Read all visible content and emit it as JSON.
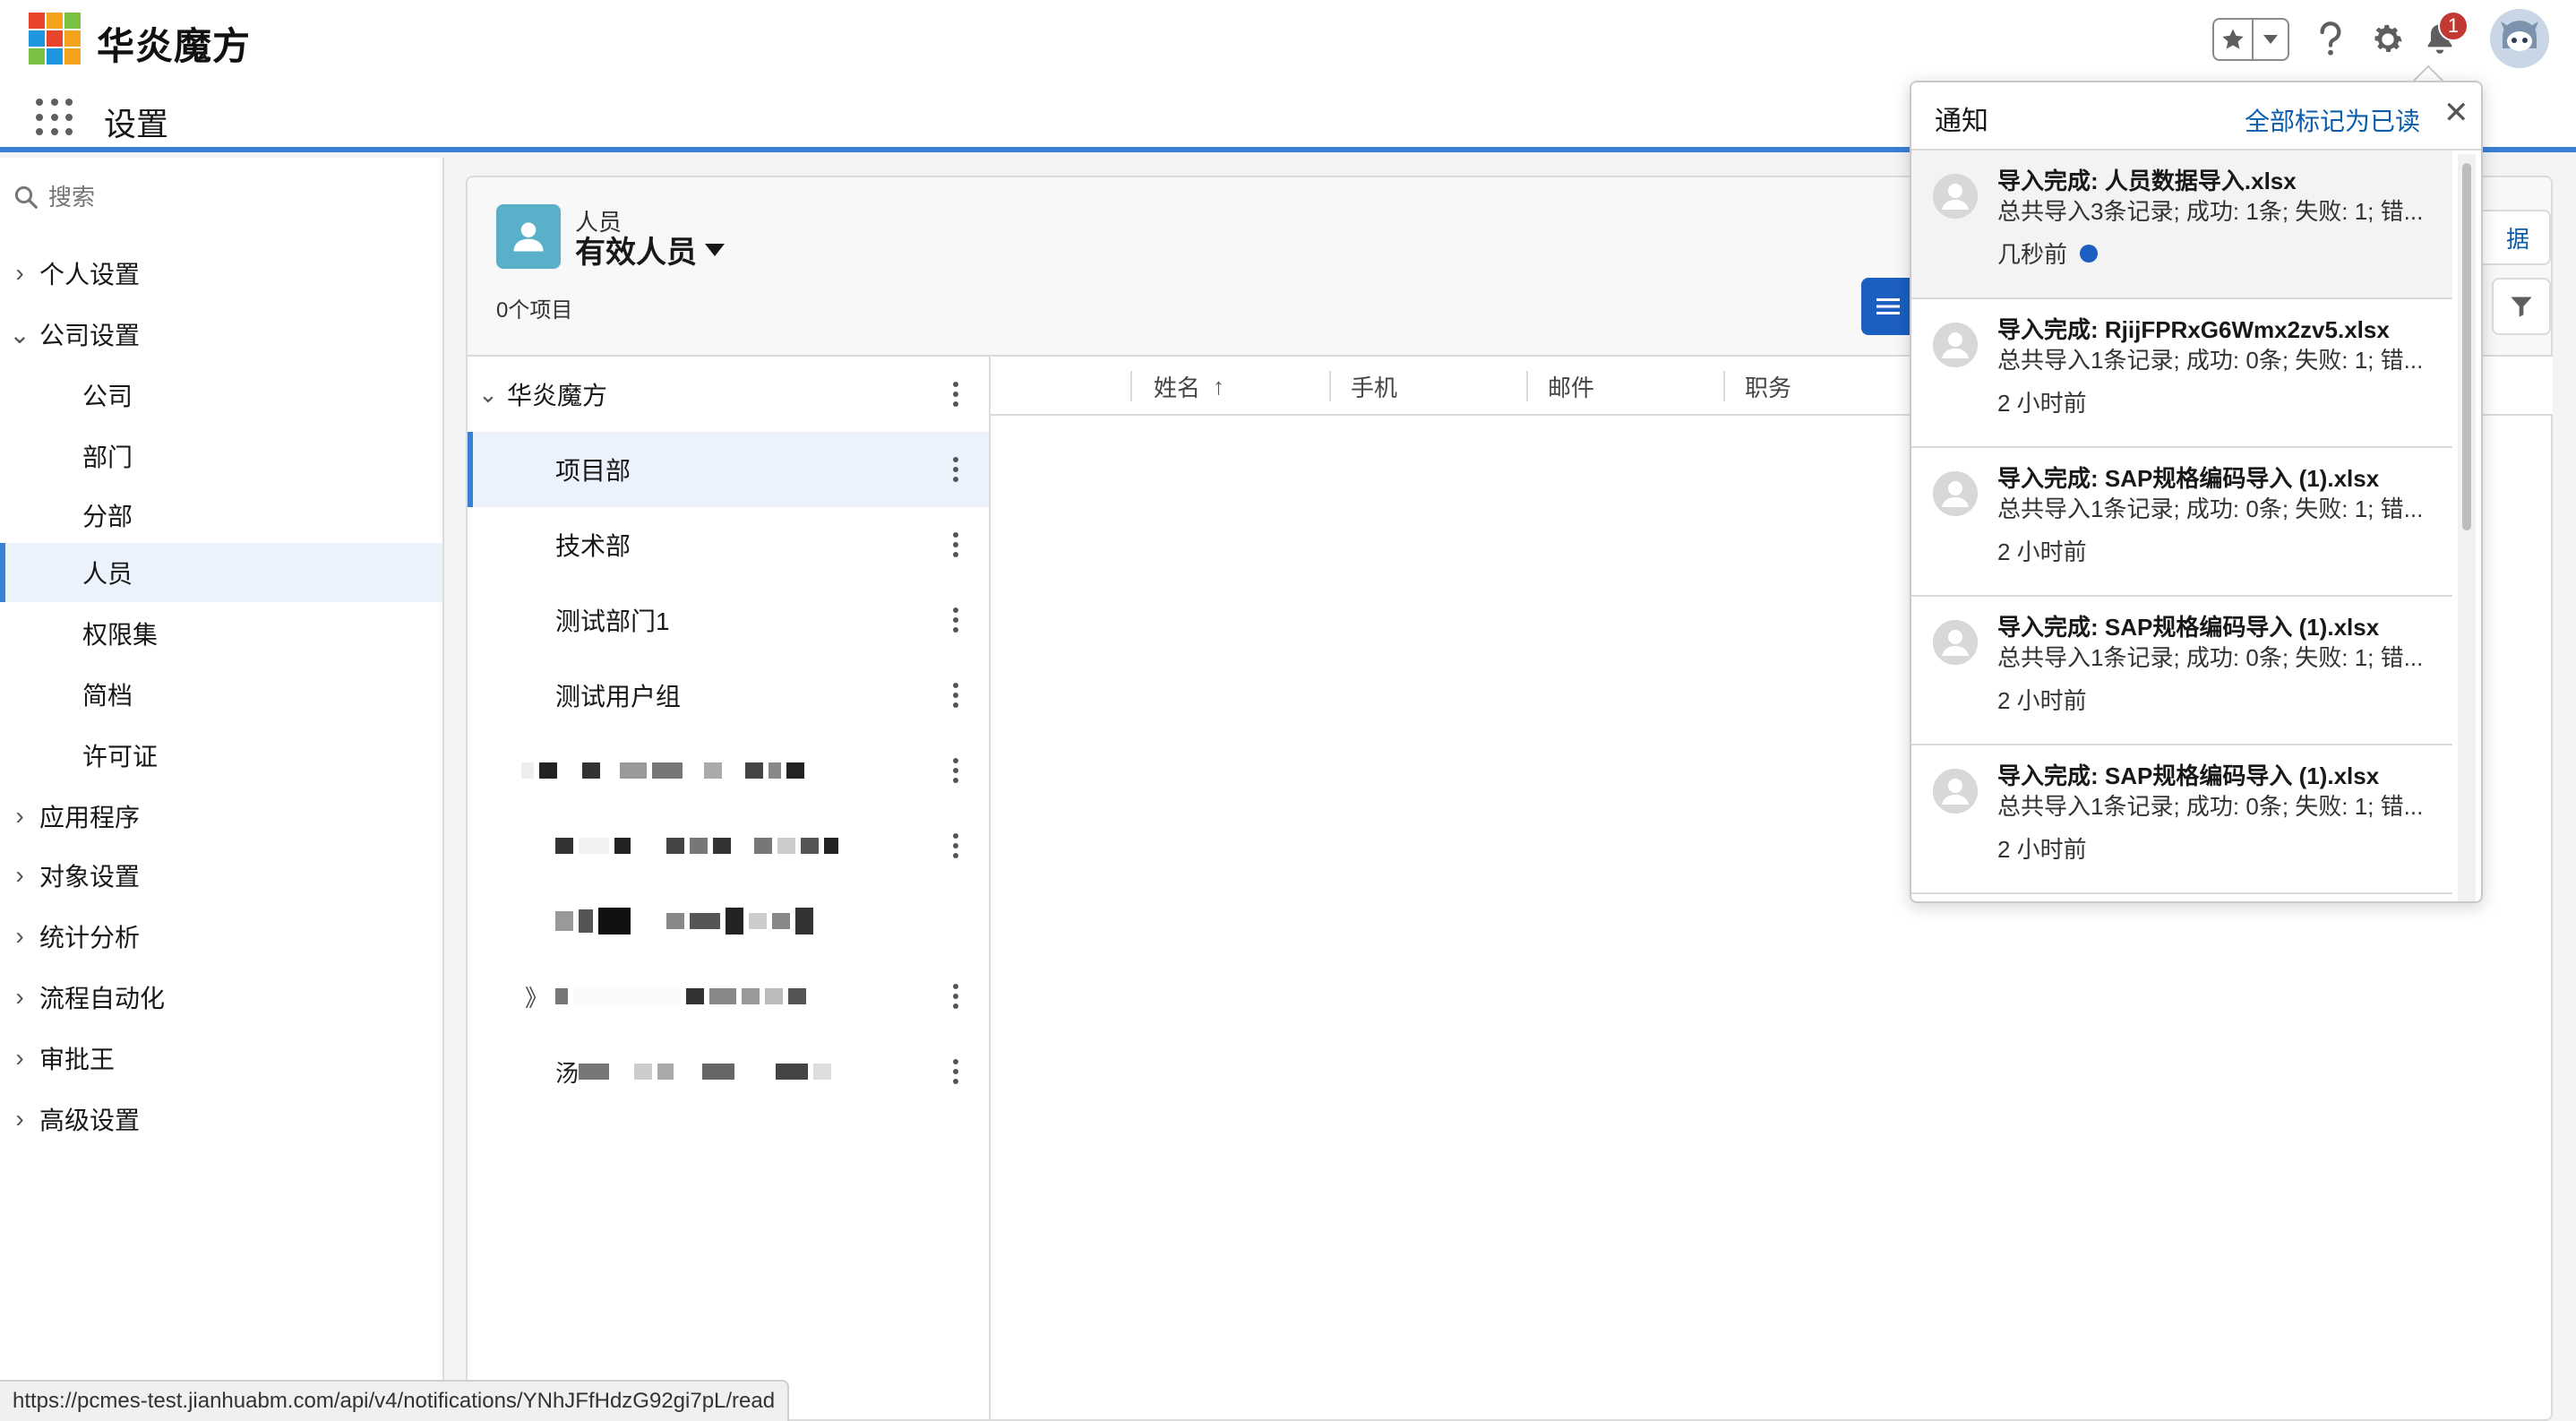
{
  "brand": {
    "name": "华炎魔方"
  },
  "app": {
    "title": "设置"
  },
  "header": {
    "notification_count": "1"
  },
  "sidebar": {
    "search_placeholder": "搜索",
    "items": [
      {
        "label": "个人设置"
      },
      {
        "label": "公司设置"
      },
      {
        "label": "公司"
      },
      {
        "label": "部门"
      },
      {
        "label": "分部"
      },
      {
        "label": "人员"
      },
      {
        "label": "权限集"
      },
      {
        "label": "简档"
      },
      {
        "label": "许可证"
      },
      {
        "label": "应用程序"
      },
      {
        "label": "对象设置"
      },
      {
        "label": "统计分析"
      },
      {
        "label": "流程自动化"
      },
      {
        "label": "审批王"
      },
      {
        "label": "高级设置"
      }
    ]
  },
  "list_view": {
    "object_label": "人员",
    "view_name": "有效人员",
    "item_count": "0个项目",
    "right_button_fragment": "据"
  },
  "tree": {
    "root": "华炎魔方",
    "nodes": [
      {
        "label": "项目部"
      },
      {
        "label": "技术部"
      },
      {
        "label": "测试部门1"
      },
      {
        "label": "测试用户组"
      }
    ],
    "partial_glyphs": [
      "》",
      "汤"
    ]
  },
  "table": {
    "columns": [
      {
        "label": "姓名"
      },
      {
        "label": "手机"
      },
      {
        "label": "邮件"
      },
      {
        "label": "职务"
      }
    ],
    "sort_indicator": "↑"
  },
  "notifications": {
    "title": "通知",
    "mark_all": "全部标记为已读",
    "close": "✕",
    "items": [
      {
        "title": "导入完成: 人员数据导入.xlsx",
        "body": "总共导入3条记录; 成功: 1条; 失败: 1; 错...",
        "time": "几秒前"
      },
      {
        "title": "导入完成: RjijFPRxG6Wmx2zv5.xlsx",
        "body": "总共导入1条记录; 成功: 0条; 失败: 1; 错...",
        "time": "2 小时前"
      },
      {
        "title": "导入完成: SAP规格编码导入 (1).xlsx",
        "body": "总共导入1条记录; 成功: 0条; 失败: 1; 错...",
        "time": "2 小时前"
      },
      {
        "title": "导入完成: SAP规格编码导入 (1).xlsx",
        "body": "总共导入1条记录; 成功: 0条; 失败: 1; 错...",
        "time": "2 小时前"
      },
      {
        "title": "导入完成: SAP规格编码导入 (1).xlsx",
        "body": "总共导入1条记录; 成功: 0条; 失败: 1; 错...",
        "time": "2 小时前"
      }
    ]
  },
  "status_url": "https://pcmes-test.jianhuabm.com/api/v4/notifications/YNhJFfHdzG92gi7pL/read",
  "colors": {
    "accent": "#3a7fd6",
    "brand_blue": "#1b5fc1",
    "badge_red": "#c23934",
    "link": "#0b5cab"
  }
}
